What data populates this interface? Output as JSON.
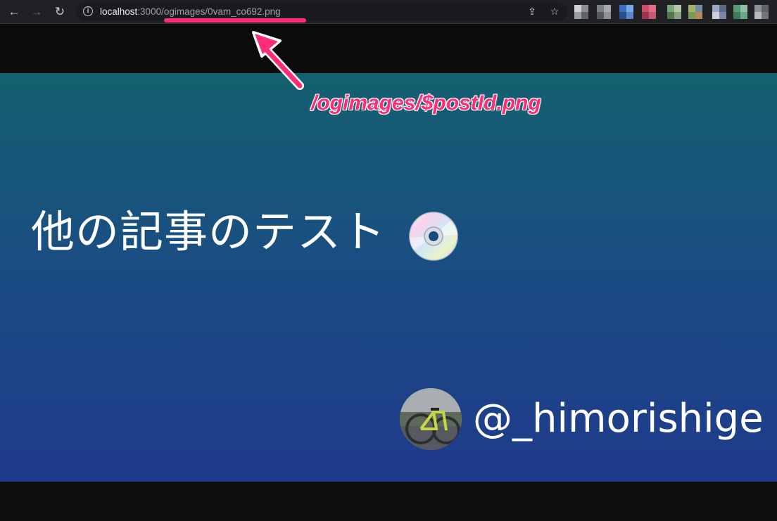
{
  "browser": {
    "back_icon": "←",
    "forward_icon": "→",
    "reload_icon": "↻",
    "info_icon": "i",
    "url_host": "localhost",
    "url_rest": ":3000/ogimages/0vam_co692.png",
    "share_icon": "⇪",
    "star_icon": "☆"
  },
  "og_image": {
    "title": "他の記事のテスト",
    "author": "@_himorishige",
    "background_top": "#14606f",
    "background_bottom": "#1f3a8c"
  },
  "annotation": {
    "text": "/ogimages/$postId.png",
    "color": "#ff2d78"
  }
}
